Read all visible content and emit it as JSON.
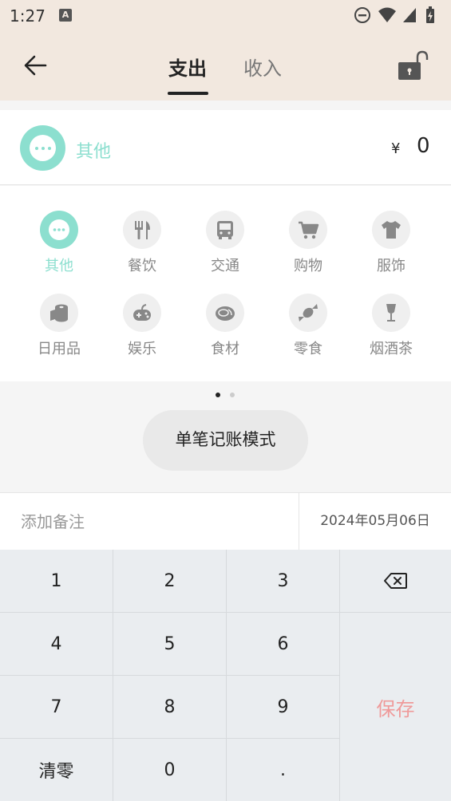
{
  "status": {
    "time": "1:27",
    "notif_glyph": "A"
  },
  "header": {
    "tabs": [
      {
        "label": "支出",
        "active": true
      },
      {
        "label": "收入",
        "active": false
      }
    ],
    "back_icon": "arrow-left-icon",
    "lock_icon": "unlock-icon"
  },
  "selected": {
    "label": "其他",
    "currency": "¥",
    "amount": "0"
  },
  "categories": [
    {
      "label": "其他",
      "icon": "more-dots-icon",
      "active": true
    },
    {
      "label": "餐饮",
      "icon": "fork-knife-icon"
    },
    {
      "label": "交通",
      "icon": "bus-icon"
    },
    {
      "label": "购物",
      "icon": "cart-icon"
    },
    {
      "label": "服饰",
      "icon": "tshirt-icon"
    },
    {
      "label": "日用品",
      "icon": "tissue-roll-icon"
    },
    {
      "label": "娱乐",
      "icon": "gamepad-icon"
    },
    {
      "label": "食材",
      "icon": "meat-icon"
    },
    {
      "label": "零食",
      "icon": "candy-icon"
    },
    {
      "label": "烟酒茶",
      "icon": "wine-glass-icon"
    }
  ],
  "pager": {
    "pages": 2,
    "current": 1
  },
  "mode_button": "单笔记账模式",
  "note": {
    "placeholder": "添加备注",
    "value": ""
  },
  "date": "2024年05月06日",
  "keypad": {
    "k1": "1",
    "k2": "2",
    "k3": "3",
    "k4": "4",
    "k5": "5",
    "k6": "6",
    "k7": "7",
    "k8": "8",
    "k9": "9",
    "clear": "清零",
    "k0": "0",
    "dot": ".",
    "save": "保存",
    "backspace_icon": "backspace-icon"
  },
  "colors": {
    "accent": "#8cdfcf",
    "header_bg": "#f2e8df",
    "save": "#ef9a9a"
  }
}
